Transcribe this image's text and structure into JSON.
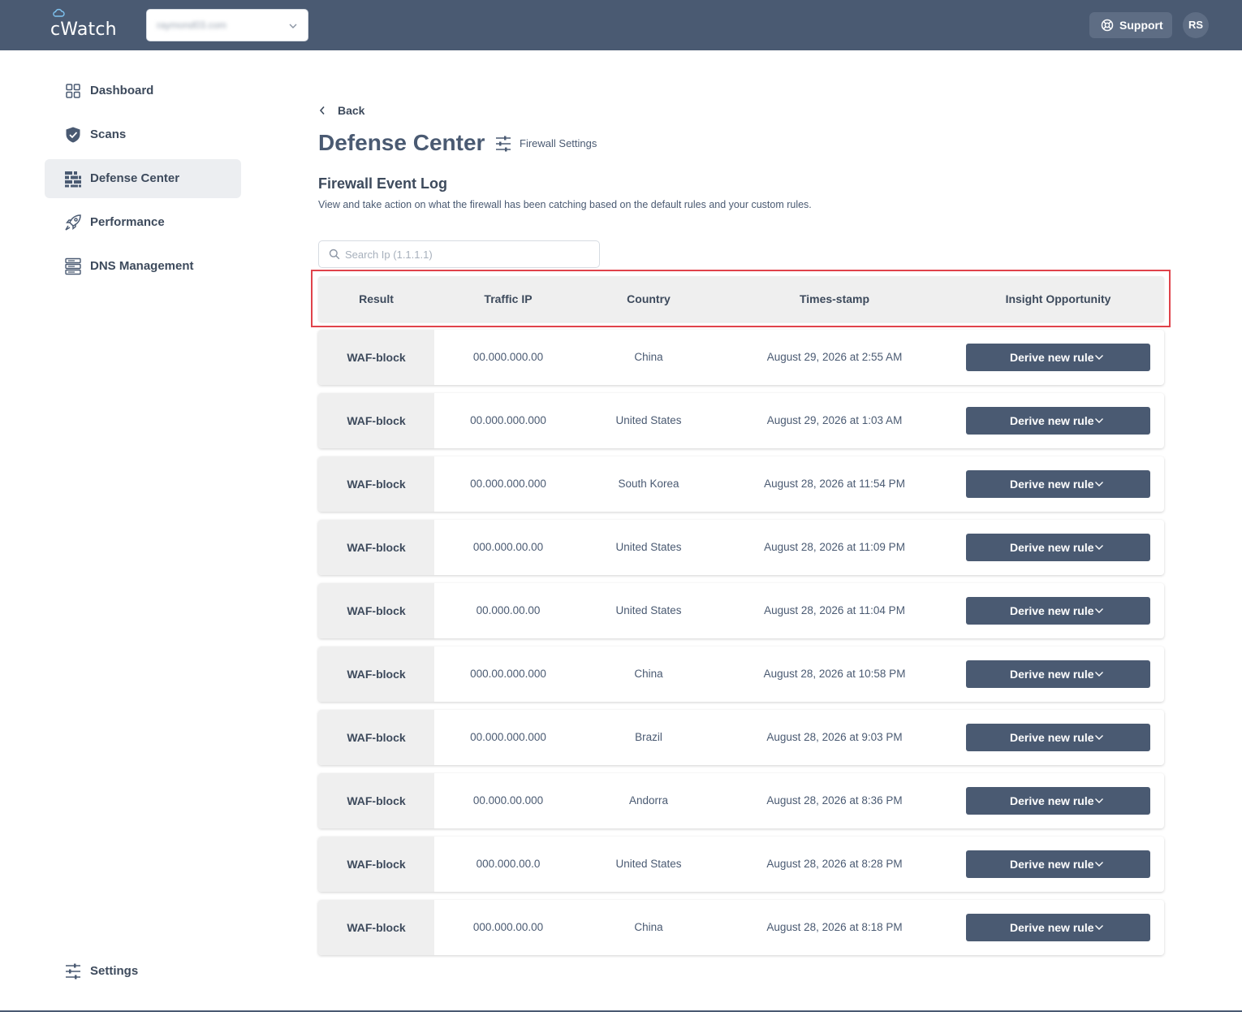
{
  "app": {
    "logo_text": "cWatch"
  },
  "header": {
    "domain_value": "raymond03.com",
    "support_label": "Support",
    "avatar_initials": "RS"
  },
  "sidebar": {
    "items": [
      {
        "label": "Dashboard",
        "icon": "dashboard-icon",
        "active": false
      },
      {
        "label": "Scans",
        "icon": "shield-icon",
        "active": false
      },
      {
        "label": "Defense Center",
        "icon": "firewall-icon",
        "active": true
      },
      {
        "label": "Performance",
        "icon": "rocket-icon",
        "active": false
      },
      {
        "label": "DNS Management",
        "icon": "server-icon",
        "active": false
      }
    ],
    "settings_label": "Settings"
  },
  "main": {
    "back_label": "Back",
    "title": "Defense Center",
    "firewall_settings_label": "Firewall Settings",
    "section_title": "Firewall Event Log",
    "section_desc": "View and take action on what the firewall has been catching based on the default rules and your custom rules.",
    "search_placeholder": "Search Ip (1.1.1.1)"
  },
  "table": {
    "columns": [
      "Result",
      "Traffic IP",
      "Country",
      "Times-stamp",
      "Insight Opportunity"
    ],
    "action_label": "Derive new rule",
    "rows": [
      {
        "result": "WAF-block",
        "ip": "00.000.000.00",
        "country": "China",
        "timestamp": "August 29, 2026 at 2:55 AM"
      },
      {
        "result": "WAF-block",
        "ip": "00.000.000.000",
        "country": "United States",
        "timestamp": "August 29, 2026 at 1:03 AM"
      },
      {
        "result": "WAF-block",
        "ip": "00.000.000.000",
        "country": "South Korea",
        "timestamp": "August 28, 2026 at 11:54 PM"
      },
      {
        "result": "WAF-block",
        "ip": "000.000.00.00",
        "country": "United States",
        "timestamp": "August 28, 2026 at 11:09 PM"
      },
      {
        "result": "WAF-block",
        "ip": "00.000.00.00",
        "country": "United States",
        "timestamp": "August 28, 2026 at 11:04 PM"
      },
      {
        "result": "WAF-block",
        "ip": "000.00.000.000",
        "country": "China",
        "timestamp": "August 28, 2026 at 10:58 PM"
      },
      {
        "result": "WAF-block",
        "ip": "00.000.000.000",
        "country": "Brazil",
        "timestamp": "August 28, 2026 at 9:03 PM"
      },
      {
        "result": "WAF-block",
        "ip": "00.000.00.000",
        "country": "Andorra",
        "timestamp": "August 28, 2026 at 8:36 PM"
      },
      {
        "result": "WAF-block",
        "ip": "000.000.00.0",
        "country": "United States",
        "timestamp": "August 28, 2026 at 8:28 PM"
      },
      {
        "result": "WAF-block",
        "ip": "000.000.00.00",
        "country": "China",
        "timestamp": "August 28, 2026 at 8:18 PM"
      }
    ]
  },
  "colors": {
    "topbar": "#4a5a72",
    "button": "#4a5a72",
    "highlight": "#e0434b",
    "result_cell": "#efefef"
  }
}
